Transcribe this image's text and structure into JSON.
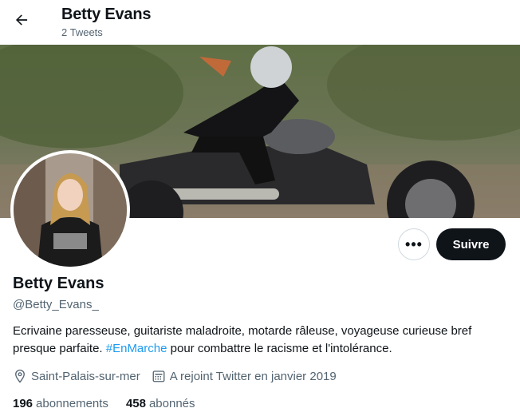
{
  "header": {
    "name": "Betty Evans",
    "tweet_count": "2 Tweets"
  },
  "profile": {
    "name": "Betty Evans",
    "handle": "@Betty_Evans_",
    "bio_part1": "Ecrivaine paresseuse, guitariste maladroite, motarde râleuse, voyageuse curieuse bref presque parfaite. ",
    "bio_hashtag": "#EnMarche",
    "bio_part2": " pour combattre le racisme et l'intolérance.",
    "location": "Saint-Palais-sur-mer",
    "joined": "A rejoint Twitter en janvier 2019",
    "following_count": "196",
    "following_label": "abonnements",
    "followers_count": "458",
    "followers_label": "abonnés"
  },
  "actions": {
    "more_label": "•••",
    "follow_label": "Suivre"
  },
  "icons": {
    "back": "arrow-left-icon",
    "location": "location-pin-icon",
    "calendar": "calendar-icon"
  },
  "colors": {
    "accent": "#1d9bf0",
    "text": "#0f1419",
    "secondary": "#536471",
    "button_dark": "#0f1419"
  }
}
